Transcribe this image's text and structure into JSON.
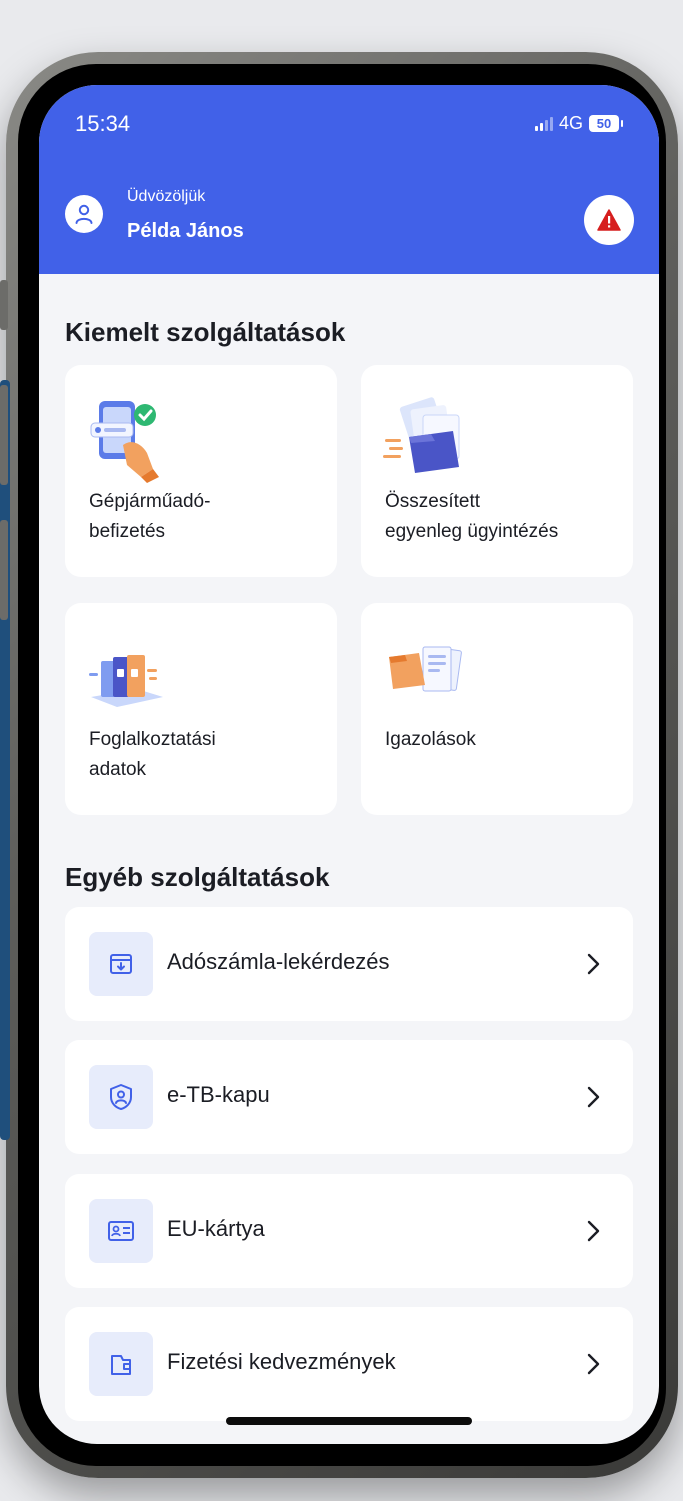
{
  "status_bar": {
    "time": "15:34",
    "network": "4G",
    "battery": "50"
  },
  "header": {
    "welcome": "Üdvözöljük",
    "user_name": "Példa János",
    "accent_color": "#4161e8",
    "alert_color": "#d61f1f"
  },
  "featured": {
    "title": "Kiemelt szolgáltatások",
    "cards": [
      {
        "line1": "Gépjárműadó-",
        "line2": "befizetés",
        "icon": "phone-payment-illustration"
      },
      {
        "line1": "Összesített",
        "line2": "egyenleg ügyintézés",
        "icon": "documents-folder-illustration"
      },
      {
        "line1": "Foglalkoztatási",
        "line2": "adatok",
        "icon": "binders-illustration"
      },
      {
        "line1": "Igazolások",
        "line2": "",
        "icon": "certificates-illustration"
      }
    ]
  },
  "other": {
    "title": "Egyéb szolgáltatások",
    "items": [
      {
        "label": "Adószámla-lekérdezés",
        "icon": "archive-icon"
      },
      {
        "label": "e-TB-kapu",
        "icon": "shield-user-icon"
      },
      {
        "label": "EU-kártya",
        "icon": "id-card-icon"
      },
      {
        "label": "Fizetési kedvezmények",
        "icon": "wallet-icon"
      }
    ]
  }
}
